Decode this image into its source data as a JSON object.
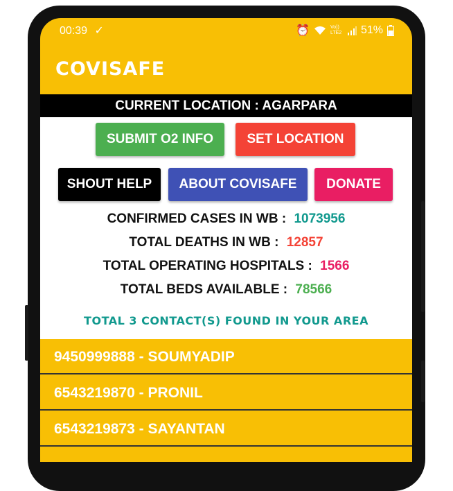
{
  "status_bar": {
    "time": "00:39",
    "battery_percent": "51%",
    "network_label": "Vo)) LTE2"
  },
  "app": {
    "title": "COVISAFE"
  },
  "location_bar": {
    "label": "CURRENT LOCATION : AGARPARA"
  },
  "buttons": {
    "submit_o2": {
      "label": "SUBMIT O2 INFO",
      "color": "#4caf50"
    },
    "set_location": {
      "label": "SET LOCATION",
      "color": "#f44336"
    },
    "shout_help": {
      "label": "SHOUT HELP",
      "color": "#000000"
    },
    "about": {
      "label": "ABOUT COVISAFE",
      "color": "#3f51b5"
    },
    "donate": {
      "label": "DONATE",
      "color": "#e91e63"
    }
  },
  "stats": [
    {
      "label": "CONFIRMED CASES IN WB :",
      "value": "1073956",
      "color": "#11998e"
    },
    {
      "label": "TOTAL DEATHS IN WB :",
      "value": "12857",
      "color": "#f44336"
    },
    {
      "label": "TOTAL OPERATING HOSPITALS :",
      "value": "1566",
      "color": "#e91e63"
    },
    {
      "label": "TOTAL BEDS AVAILABLE :",
      "value": "78566",
      "color": "#4caf50"
    }
  ],
  "contacts_found": "TOTAL 3 CONTACT(S) FOUND IN YOUR AREA",
  "contacts": [
    {
      "text": "9450999888 - SOUMYADIP"
    },
    {
      "text": "6543219870 - PRONIL"
    },
    {
      "text": "6543219873 - SAYANTAN"
    }
  ],
  "colors": {
    "primary": "#f8bf05",
    "teal": "#11998e"
  },
  "icons": [
    "download-done-icon",
    "alarm-icon",
    "wifi-icon",
    "signal-icon",
    "battery-icon"
  ]
}
